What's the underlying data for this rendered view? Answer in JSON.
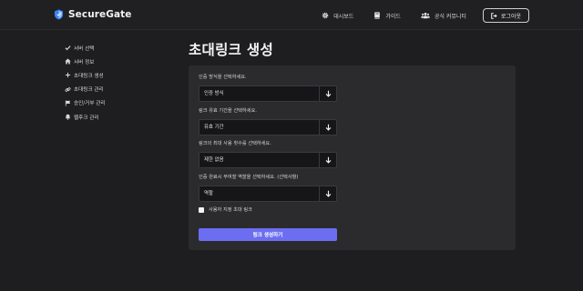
{
  "brand": {
    "name": "SecureGate",
    "icon": "shield-icon"
  },
  "nav": {
    "items": [
      {
        "label": "대시보드",
        "icon": "gear-icon"
      },
      {
        "label": "가이드",
        "icon": "book-icon"
      },
      {
        "label": "공식 커뮤니티",
        "icon": "users-icon"
      }
    ],
    "login_label": "로그아웃",
    "login_icon": "logout-icon"
  },
  "sidebar": {
    "items": [
      {
        "label": "서버 선택",
        "icon": "check-icon"
      },
      {
        "label": "서버 정보",
        "icon": "home-icon"
      },
      {
        "label": "초대링크 생성",
        "icon": "plus-icon"
      },
      {
        "label": "초대링크 관리",
        "icon": "link-icon"
      },
      {
        "label": "승인/거부 관리",
        "icon": "flag-icon"
      },
      {
        "label": "웹후크 관리",
        "icon": "bell-icon"
      }
    ]
  },
  "page": {
    "title": "초대링크 생성"
  },
  "form": {
    "fields": [
      {
        "label": "인증 방식을 선택하세요.",
        "value": "인증 방식"
      },
      {
        "label": "링크 유효 기간을 선택하세요.",
        "value": "유효 기간"
      },
      {
        "label": "링크의 최대 사용 횟수를 선택하세요.",
        "value": "제한 없음"
      },
      {
        "label": "인증 완료시 부여할 역할을 선택하세요. (선택사항)",
        "value": "역할"
      }
    ],
    "checkbox_label": "사용자 지정 초대 링크",
    "checkbox_checked": false,
    "submit_label": "링크 생성하기"
  },
  "colors": {
    "background": "#1e1e20",
    "card": "#2b2b2e",
    "accent": "#6b6ef0",
    "brand_icon": "#3b82f6"
  }
}
